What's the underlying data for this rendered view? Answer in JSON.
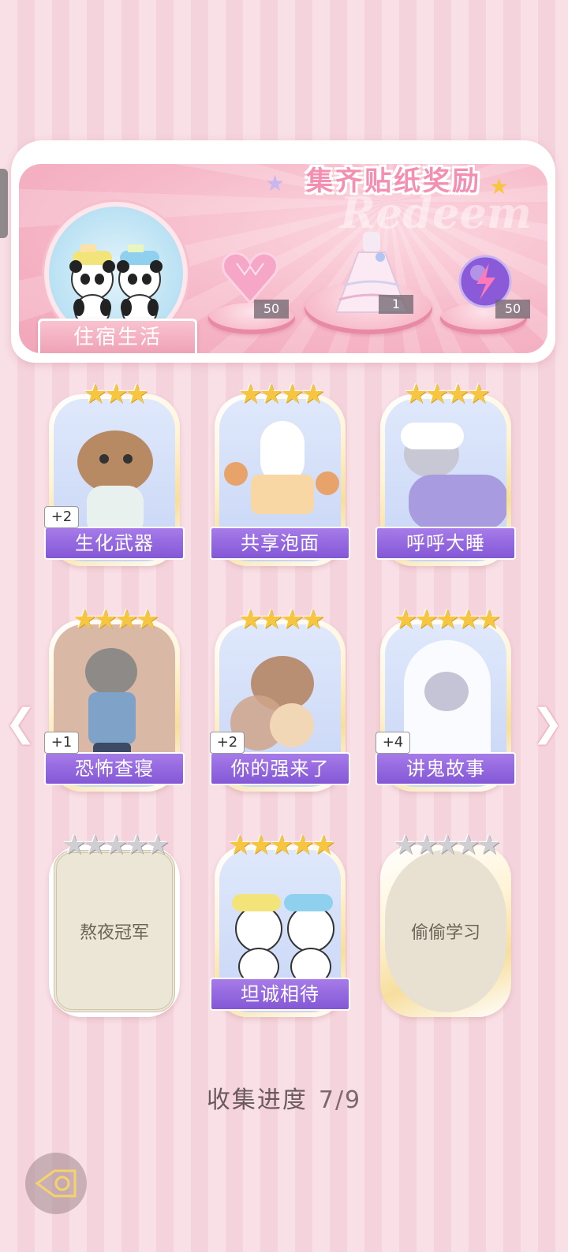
{
  "banner": {
    "title": "集齐贴纸奖励",
    "watermark": "Redeem",
    "panda_label": "住宿生活",
    "rewards": [
      {
        "icon": "pink-heart-gem-icon",
        "count": "50"
      },
      {
        "icon": "lace-dress-icon",
        "count": "1"
      },
      {
        "icon": "lightning-orb-icon",
        "count": "50"
      }
    ]
  },
  "cards": [
    {
      "label": "生化武器",
      "stars": 3,
      "max_stars": 3,
      "bonus": "+2",
      "art": "capybara-pajamas"
    },
    {
      "label": "共享泡面",
      "stars": 4,
      "max_stars": 4,
      "bonus": "",
      "art": "bunny-noodles"
    },
    {
      "label": "呼呼大睡",
      "stars": 4,
      "max_stars": 4,
      "bonus": "",
      "art": "boy-sleeping"
    },
    {
      "label": "恐怖查寝",
      "stars": 4,
      "max_stars": 4,
      "bonus": "+1",
      "art": "dorm-auntie"
    },
    {
      "label": "你的强来了",
      "stars": 4,
      "max_stars": 4,
      "bonus": "+2",
      "art": "cockroach"
    },
    {
      "label": "讲鬼故事",
      "stars": 5,
      "max_stars": 5,
      "bonus": "+4",
      "art": "boy-ghost"
    },
    {
      "label": "熬夜冠军",
      "stars": 0,
      "max_stars": 5,
      "bonus": "",
      "art": "locked-parchment"
    },
    {
      "label": "坦诚相待",
      "stars": 5,
      "max_stars": 5,
      "bonus": "",
      "art": "pandas-shower"
    },
    {
      "label": "偷偷学习",
      "stars": 0,
      "max_stars": 5,
      "bonus": "",
      "art": "locked-oval"
    }
  ],
  "progress": {
    "label": "收集进度",
    "value": "7/9"
  },
  "nav": {
    "prev_icon": "chevron-left-icon",
    "next_icon": "chevron-right-icon",
    "back_icon": "back-arrow-icon"
  },
  "colors": {
    "label_purple": "#8c5fdc",
    "star_gold": "#f6c640",
    "banner_pink": "#f4a9bb"
  }
}
